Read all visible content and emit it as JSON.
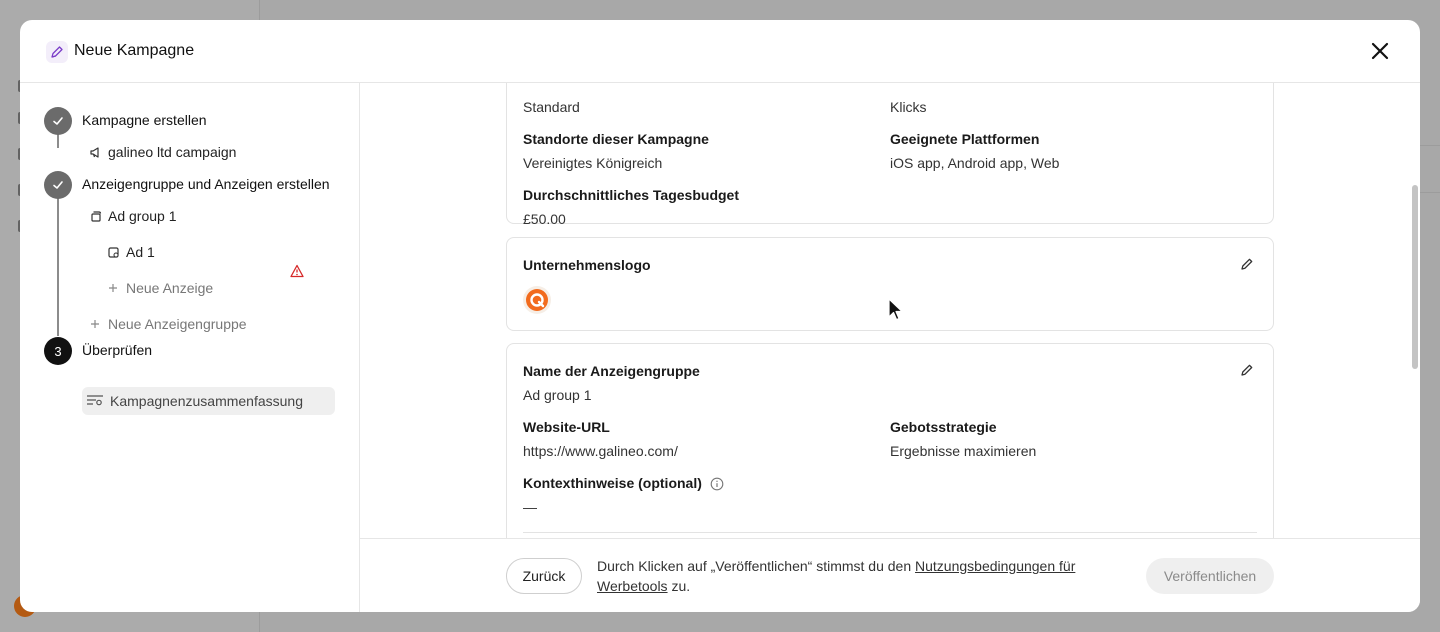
{
  "modal": {
    "title": "Neue Kampagne"
  },
  "steps": {
    "step1": {
      "label": "Kampagne erstellen",
      "status": "done"
    },
    "campaign": {
      "label": "galineo ltd campaign"
    },
    "step2": {
      "label": "Anzeigengruppe und Anzeigen erstellen",
      "status": "done"
    },
    "adgroup": {
      "label": "Ad group 1"
    },
    "ad": {
      "label": "Ad 1",
      "warning": true
    },
    "new_ad": {
      "label": "Neue Anzeige"
    },
    "new_adgroup": {
      "label": "Neue Anzeigengruppe"
    },
    "step3": {
      "number": "3",
      "label": "Überprüfen",
      "status": "active"
    },
    "summary": {
      "label": "Kampagnenzusammenfassung"
    }
  },
  "campaign_card": {
    "objective_value": "Standard",
    "billing_value": "Klicks",
    "locations_label": "Standorte dieser Kampagne",
    "locations_value": "Vereinigtes Königreich",
    "platforms_label": "Geeignete Plattformen",
    "platforms_value": "iOS app, Android app, Web",
    "budget_label": "Durchschnittliches Tagesbudget",
    "budget_value": "£50.00"
  },
  "logo_card": {
    "label": "Unternehmenslogo"
  },
  "adgroup_card": {
    "name_label": "Name der Anzeigengruppe",
    "name_value": "Ad group 1",
    "url_label": "Website-URL",
    "url_value": "https://www.galineo.com/",
    "bid_label": "Gebotsstrategie",
    "bid_value": "Ergebnisse maximieren",
    "context_label": "Kontexthinweise (optional)",
    "context_value": "—"
  },
  "footer": {
    "back_label": "Zurück",
    "terms_prefix": "Durch Klicken auf „Veröffentlichen“ stimmst du den ",
    "terms_link": "Nutzungsbedingungen für Werbetools",
    "terms_suffix": " zu.",
    "publish_label": "Veröffentlichen"
  },
  "colors": {
    "accent_logo": "#f26b1d",
    "warning": "#d62828",
    "header_icon": "#7a3cc8"
  }
}
